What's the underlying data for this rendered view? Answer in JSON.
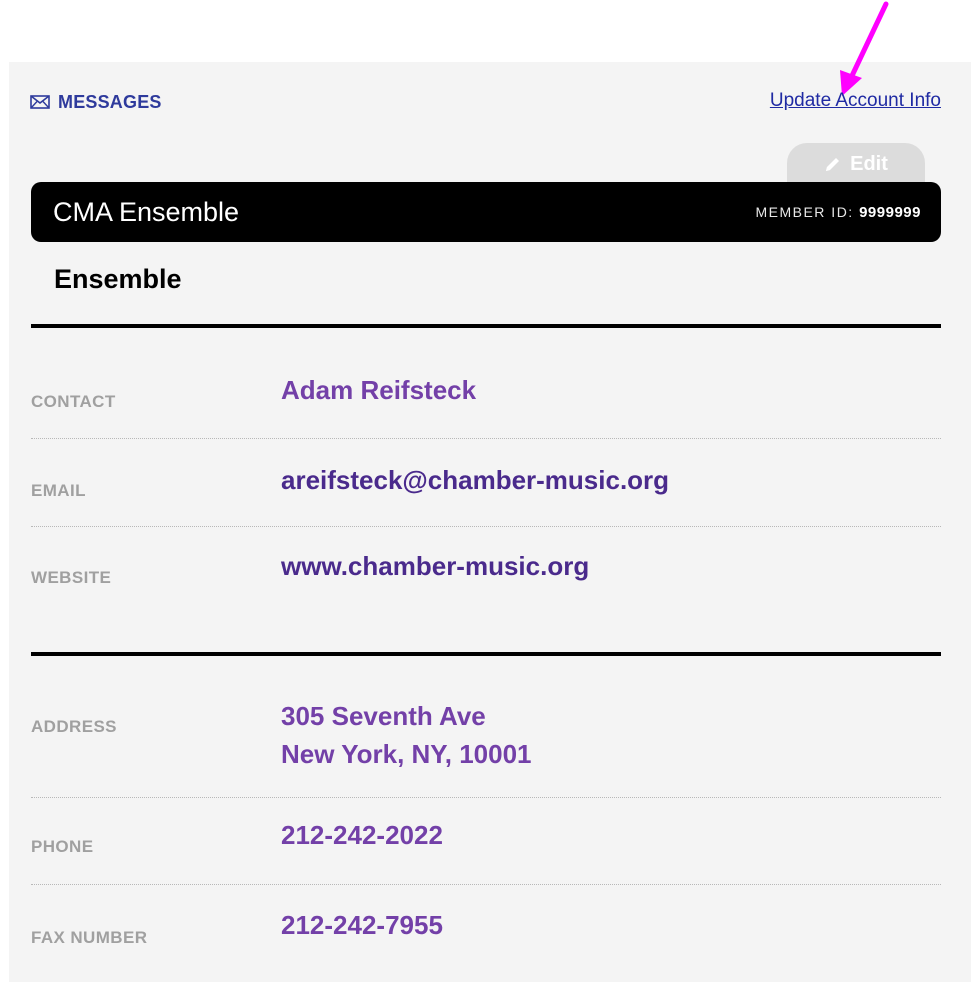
{
  "header": {
    "messages_label": "MESSAGES",
    "update_link": "Update Account Info",
    "edit_label": "Edit"
  },
  "member": {
    "name": "CMA Ensemble",
    "id_label": "MEMBER ID:",
    "id_value": "9999999",
    "type": "Ensemble"
  },
  "contact_section": [
    {
      "label": "CONTACT",
      "value": "Adam Reifsteck"
    },
    {
      "label": "EMAIL",
      "value": "areifsteck@chamber-music.org"
    },
    {
      "label": "WEBSITE",
      "value": "www.chamber-music.org"
    }
  ],
  "address_section": [
    {
      "label": "ADDRESS",
      "value_line1": "305 Seventh Ave",
      "value_line2": "New York, NY, 10001"
    },
    {
      "label": "PHONE",
      "value": "212-242-2022"
    },
    {
      "label": "FAX NUMBER",
      "value": "212-242-7955"
    }
  ],
  "colors": {
    "link": "#1f2aa3",
    "messages": "#2e3a9c",
    "value": "#7340a8",
    "annotation_arrow": "#ff00ff"
  }
}
